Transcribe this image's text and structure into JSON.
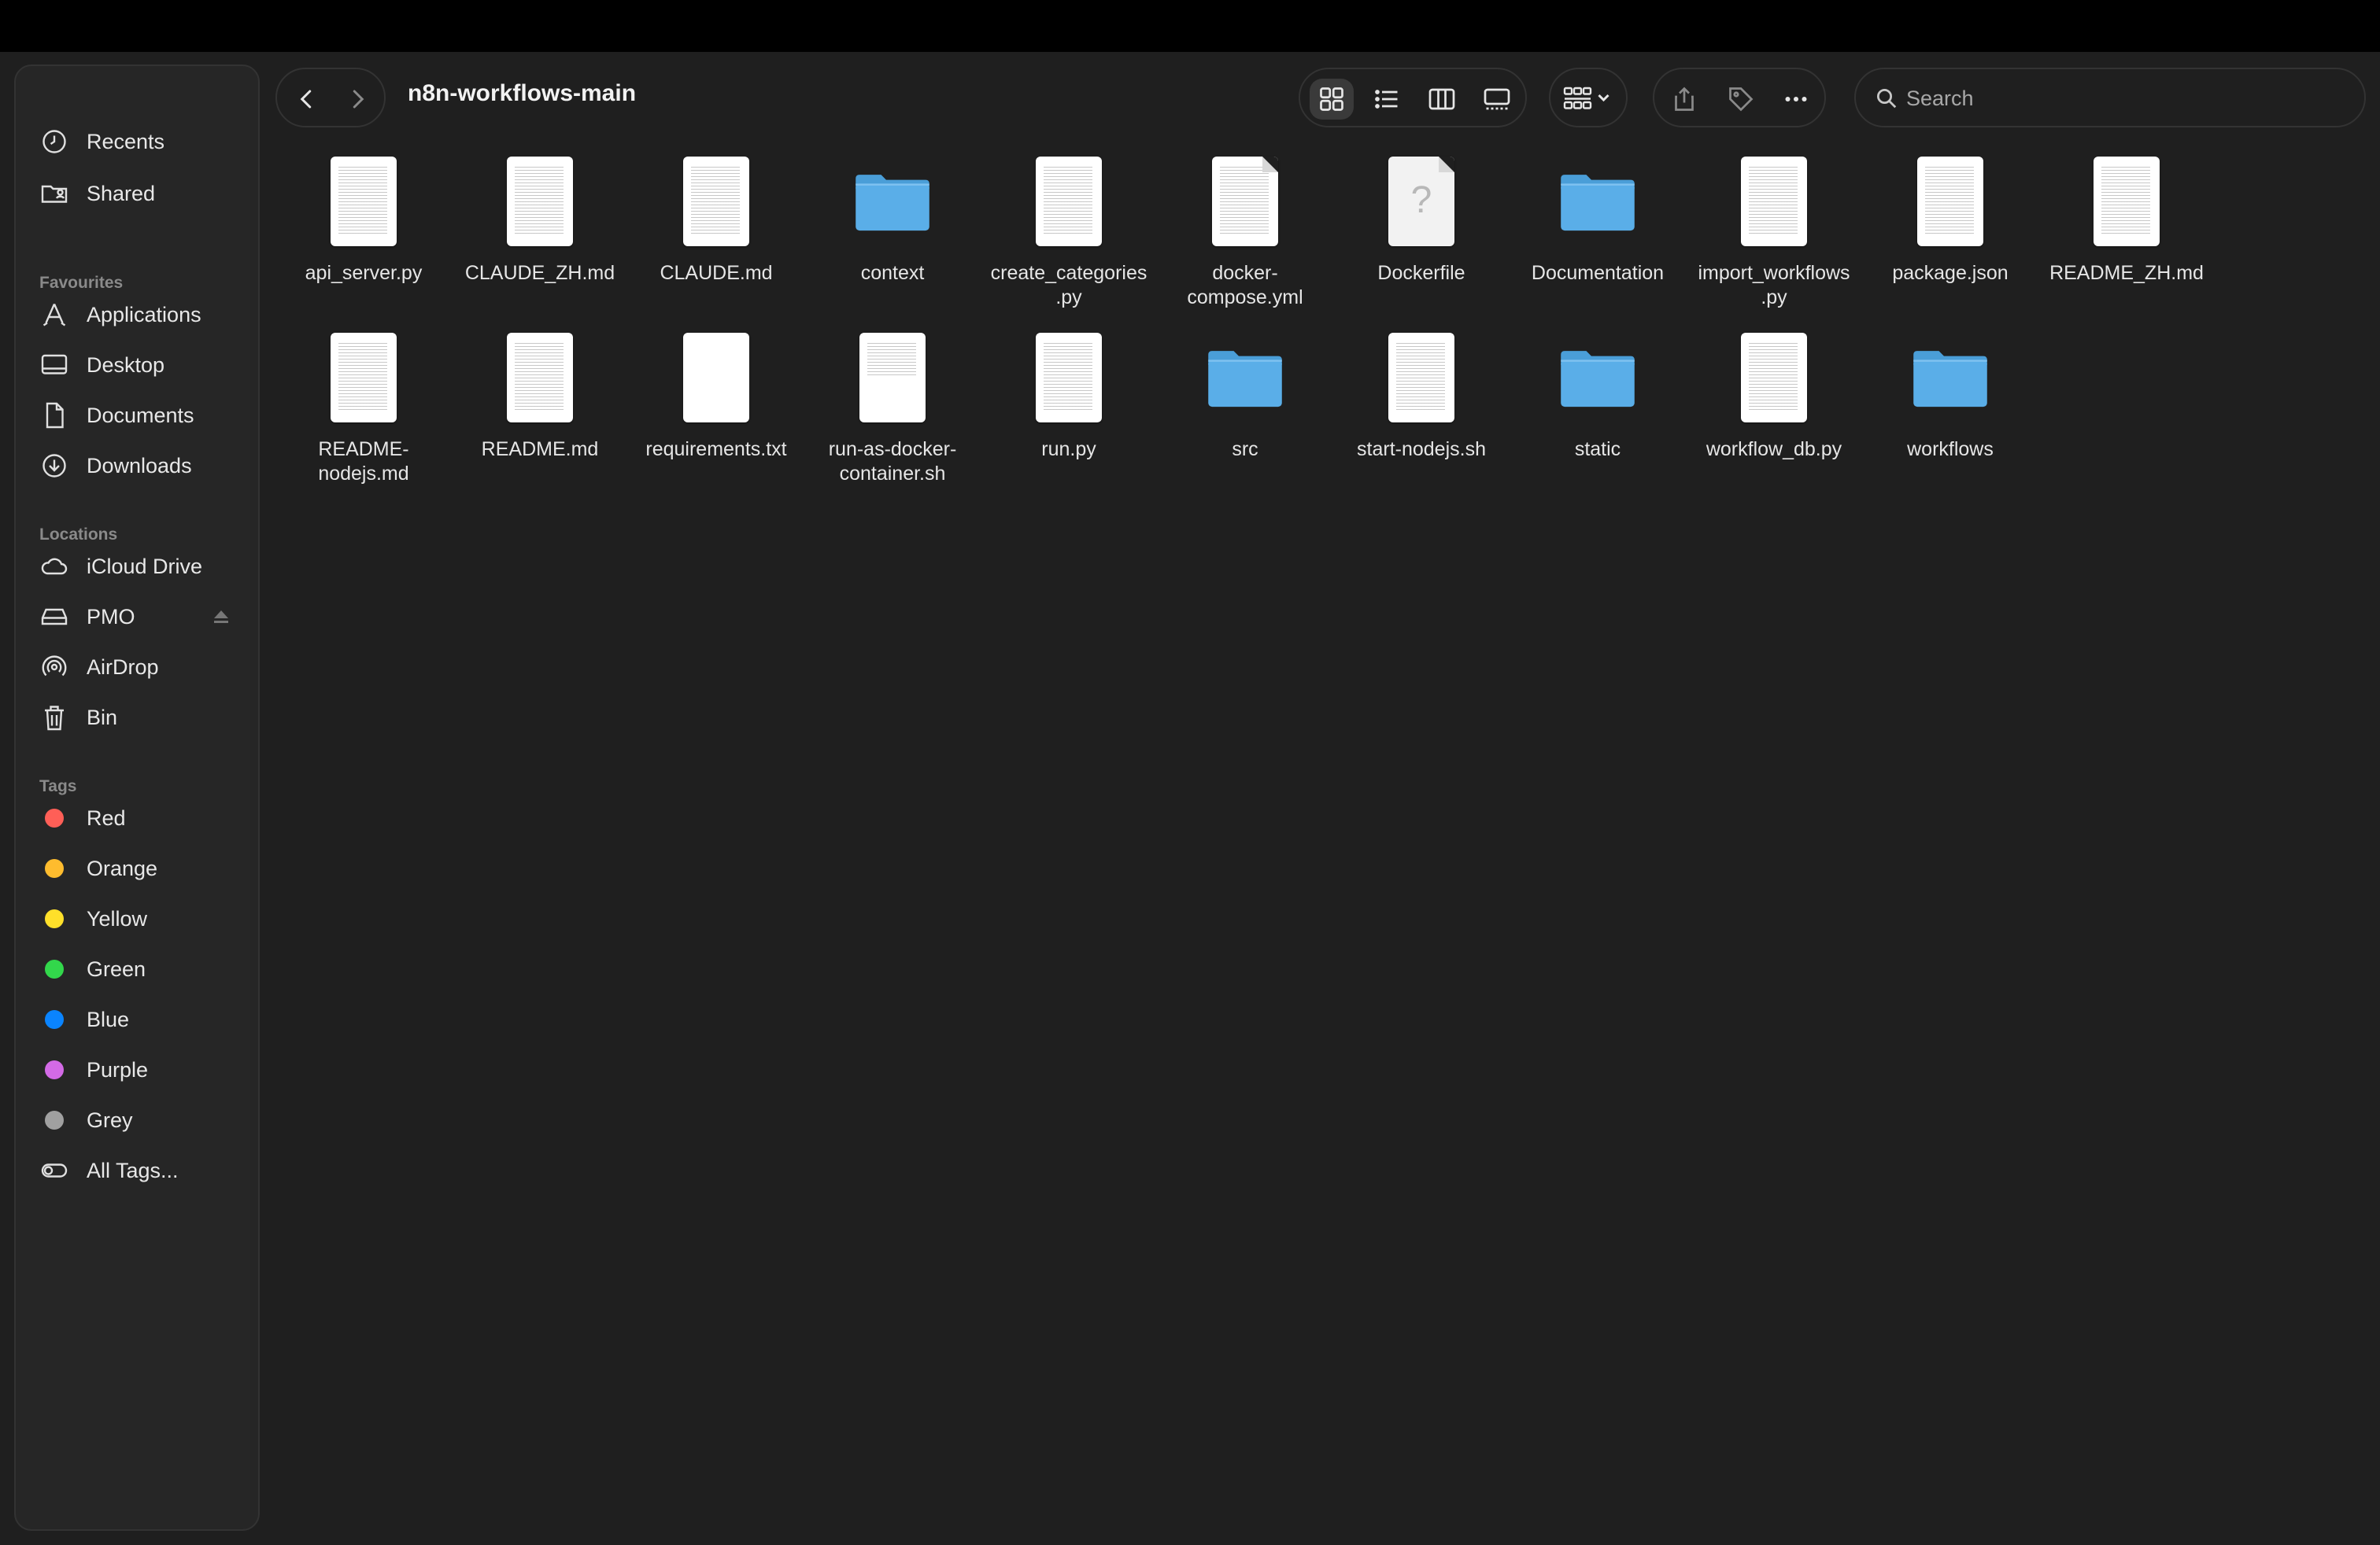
{
  "window": {
    "title": "n8n-workflows-main"
  },
  "sidebar": {
    "top_items": [
      {
        "label": "Recents",
        "icon": "clock-icon"
      },
      {
        "label": "Shared",
        "icon": "shared-folder-icon"
      }
    ],
    "favourites": {
      "heading": "Favourites",
      "items": [
        {
          "label": "Applications",
          "icon": "applications-icon"
        },
        {
          "label": "Desktop",
          "icon": "desktop-icon"
        },
        {
          "label": "Documents",
          "icon": "document-icon"
        },
        {
          "label": "Downloads",
          "icon": "download-icon"
        }
      ]
    },
    "locations": {
      "heading": "Locations",
      "items": [
        {
          "label": "iCloud Drive",
          "icon": "cloud-icon"
        },
        {
          "label": "PMO",
          "icon": "drive-icon"
        },
        {
          "label": "AirDrop",
          "icon": "airdrop-icon"
        },
        {
          "label": "Bin",
          "icon": "trash-icon"
        }
      ]
    },
    "tags": {
      "heading": "Tags",
      "items": [
        {
          "label": "Red",
          "color": "#ff5f57"
        },
        {
          "label": "Orange",
          "color": "#febc2e"
        },
        {
          "label": "Yellow",
          "color": "#ffe02a"
        },
        {
          "label": "Green",
          "color": "#32d74b"
        },
        {
          "label": "Blue",
          "color": "#0a84ff"
        },
        {
          "label": "Purple",
          "color": "#d36ae6"
        },
        {
          "label": "Grey",
          "color": "#a0a0a0"
        },
        {
          "label": "All Tags...",
          "icon": "tags-icon"
        }
      ]
    }
  },
  "toolbar": {
    "back_icon": "chevron-left-icon",
    "forward_icon": "chevron-right-icon",
    "views": [
      "icon-view",
      "list-view",
      "column-view",
      "gallery-view"
    ],
    "active_view": "icon-view",
    "search_placeholder": "Search"
  },
  "files": {
    "row1": [
      {
        "name": "api_server.py",
        "type": "doc"
      },
      {
        "name": "CLAUDE_ZH.md",
        "type": "doc"
      },
      {
        "name": "CLAUDE.md",
        "type": "doc"
      },
      {
        "name": "context",
        "type": "folder"
      },
      {
        "name": "create_categories\n.py",
        "type": "doc"
      },
      {
        "name": "docker-\ncompose.yml",
        "type": "doc"
      },
      {
        "name": "Dockerfile",
        "type": "unknown"
      },
      {
        "name": "Documentation",
        "type": "folder"
      },
      {
        "name": "import_workflows\n.py",
        "type": "doc"
      },
      {
        "name": "package.json",
        "type": "doc"
      },
      {
        "name": "README_ZH.md",
        "type": "doc"
      }
    ],
    "row2": [
      {
        "name": "README-\nnodejs.md",
        "type": "doc"
      },
      {
        "name": "README.md",
        "type": "doc"
      },
      {
        "name": "requirements.txt",
        "type": "blank"
      },
      {
        "name": "run-as-docker-\ncontainer.sh",
        "type": "doc"
      },
      {
        "name": "run.py",
        "type": "doc"
      },
      {
        "name": "src",
        "type": "folder"
      },
      {
        "name": "start-nodejs.sh",
        "type": "doc"
      },
      {
        "name": "static",
        "type": "folder"
      },
      {
        "name": "workflow_db.py",
        "type": "doc"
      },
      {
        "name": "workflows",
        "type": "folder"
      }
    ]
  },
  "colors": {
    "folder": "#5aaee8",
    "folder_tab": "#4a9ed8",
    "window_bg": "#1f1f1f",
    "sidebar_bg": "#262626"
  }
}
